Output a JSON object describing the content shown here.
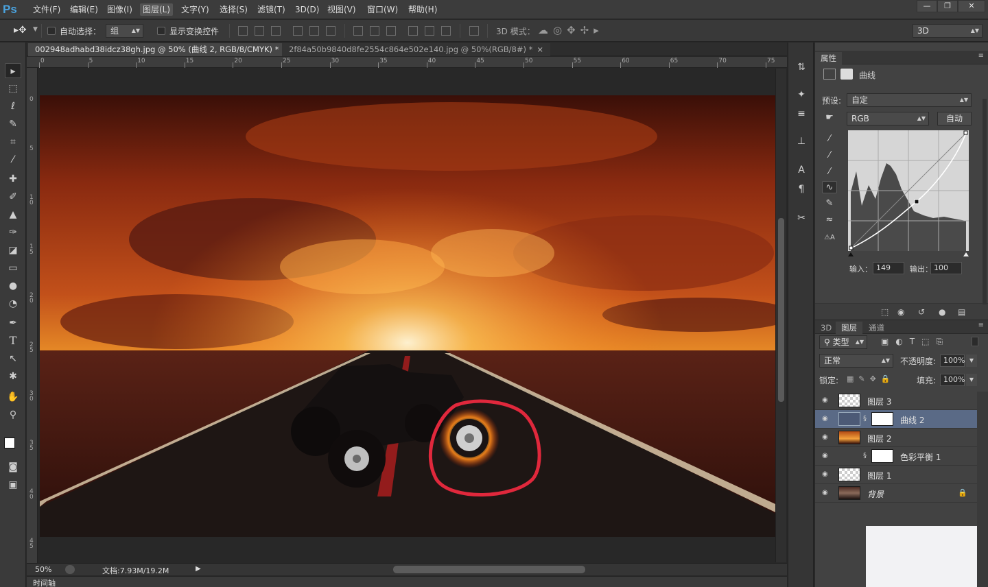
{
  "app": {
    "logo": "Ps"
  },
  "menu": [
    "文件(F)",
    "编辑(E)",
    "图像(I)",
    "图层(L)",
    "文字(Y)",
    "选择(S)",
    "滤镜(T)",
    "3D(D)",
    "视图(V)",
    "窗口(W)",
    "帮助(H)"
  ],
  "menu_active": "图层(L)",
  "window_controls": {
    "minimize": "—",
    "restore": "❐",
    "close": "✕"
  },
  "options": {
    "auto_select_label": "自动选择：",
    "auto_select_value": "组",
    "show_transform_label": "显示变换控件",
    "mode3d_label": "3D 模式：",
    "workspace_value": "3D"
  },
  "doc_tabs": [
    {
      "label": "002948adhabd38idcz38gh.jpg @ 50% (曲线 2, RGB/8/CMYK) *",
      "close": "×"
    },
    {
      "label": "2f84a50b9840d8fe2554c864e502e140.jpg @ 50%(RGB/8#) *",
      "close": "×"
    }
  ],
  "ruler": {
    "h_ticks": [
      "0",
      "5",
      "10",
      "15",
      "20",
      "25",
      "30",
      "35",
      "40",
      "45",
      "50",
      "55",
      "60",
      "65",
      "70",
      "75"
    ],
    "v_ticks": [
      "0",
      "5",
      "10",
      "15",
      "20",
      "25",
      "30",
      "35",
      "40",
      "45"
    ]
  },
  "status": {
    "zoom": "50%",
    "doc": "文档:7.93M/19.2M"
  },
  "timeline_label": "时间轴",
  "properties": {
    "tab": "属性",
    "title": "曲线",
    "preset_label": "预设:",
    "preset_value": "自定",
    "channel_value": "RGB",
    "auto_button": "自动",
    "input_label": "输入：",
    "input_value": "149",
    "output_label": "输出：",
    "output_value": "100"
  },
  "layers_panel": {
    "tabs": [
      "3D",
      "图层",
      "通道"
    ],
    "active_tab": "图层",
    "filter_value": "类型",
    "blend_mode": "正常",
    "opacity_label": "不透明度:",
    "opacity_value": "100%",
    "lock_label": "锁定:",
    "fill_label": "填充:",
    "fill_value": "100%",
    "layers": [
      {
        "name": "图层 3",
        "type": "pixel",
        "selected": false
      },
      {
        "name": "曲线 2",
        "type": "adjustment",
        "selected": true
      },
      {
        "name": "图层 2",
        "type": "fire",
        "selected": false
      },
      {
        "name": "色彩平衡 1",
        "type": "adjustment",
        "selected": false
      },
      {
        "name": "图层 1",
        "type": "pixel",
        "selected": false
      },
      {
        "name": "背景",
        "type": "background",
        "selected": false,
        "locked": true
      }
    ]
  },
  "colors": {
    "accent": "#4aa3df",
    "selected_layer": "#5a6a86",
    "annotation": "#e0283c"
  }
}
